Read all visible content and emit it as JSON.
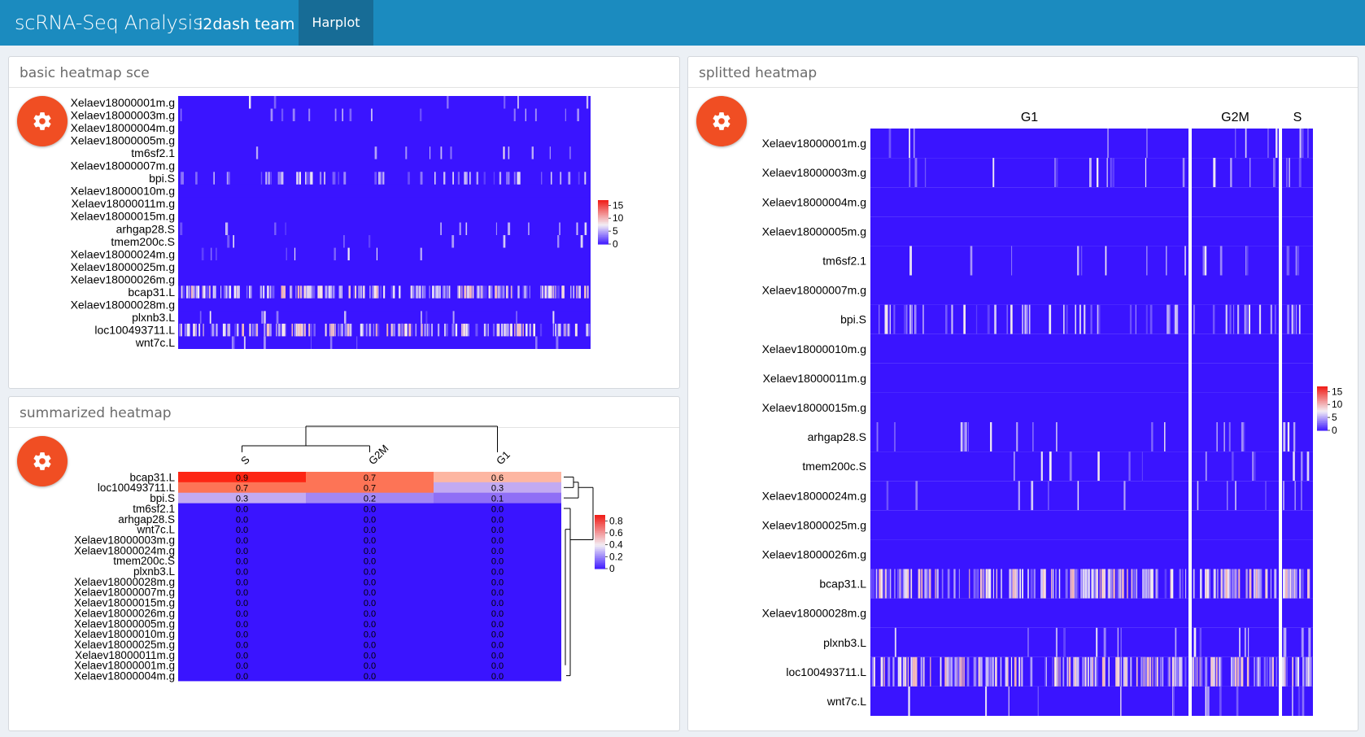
{
  "app": {
    "title": "scRNA-Seq Analysis",
    "author": "i2dash team",
    "tabs": [
      {
        "label": "Harplot",
        "active": true
      }
    ]
  },
  "colors": {
    "navbar": "#1b8bbf",
    "active_tab": "#176c96",
    "gear_button": "#f04e23",
    "heat_low": "#3a14ff",
    "heat_mid": "#f3eef5",
    "heat_high": "#f0211c"
  },
  "icons": {
    "settings": "gear-icon"
  },
  "panels": {
    "basic": {
      "title": "basic heatmap sce"
    },
    "summarized": {
      "title": "summarized heatmap"
    },
    "splitted": {
      "title": "splitted heatmap"
    }
  },
  "chart_data": [
    {
      "id": "basic",
      "type": "heatmap",
      "rows": [
        "Xelaev18000001m.g",
        "Xelaev18000003m.g",
        "Xelaev18000004m.g",
        "Xelaev18000005m.g",
        "tm6sf2.1",
        "Xelaev18000007m.g",
        "bpi.S",
        "Xelaev18000010m.g",
        "Xelaev18000011m.g",
        "Xelaev18000015m.g",
        "arhgap28.S",
        "tmem200c.S",
        "Xelaev18000024m.g",
        "Xelaev18000025m.g",
        "Xelaev18000026m.g",
        "bcap31.L",
        "Xelaev18000028m.g",
        "plxnb3.L",
        "loc100493711.L",
        "wnt7c.L"
      ],
      "row_expression_level": [
        0.01,
        0.05,
        0.0,
        0.0,
        0.03,
        0.0,
        0.2,
        0.0,
        0.0,
        0.0,
        0.04,
        0.02,
        0.02,
        0.0,
        0.0,
        0.7,
        0.0,
        0.03,
        0.6,
        0.02
      ],
      "legend": {
        "ticks": [
          "15",
          "10",
          "5",
          "0"
        ],
        "range": [
          0,
          17
        ]
      }
    },
    {
      "id": "summarized",
      "type": "heatmap",
      "columns": [
        "S",
        "G2M",
        "G1"
      ],
      "rows": [
        "bcap31.L",
        "loc100493711.L",
        "bpi.S",
        "tm6sf2.1",
        "arhgap28.S",
        "wnt7c.L",
        "Xelaev18000003m.g",
        "Xelaev18000024m.g",
        "tmem200c.S",
        "plxnb3.L",
        "Xelaev18000028m.g",
        "Xelaev18000007m.g",
        "Xelaev18000015m.g",
        "Xelaev18000026m.g",
        "Xelaev18000005m.g",
        "Xelaev18000010m.g",
        "Xelaev18000025m.g",
        "Xelaev18000011m.g",
        "Xelaev18000001m.g",
        "Xelaev18000004m.g"
      ],
      "values": [
        [
          0.9,
          0.7,
          0.6
        ],
        [
          0.7,
          0.7,
          0.3
        ],
        [
          0.3,
          0.2,
          0.1
        ],
        [
          0.0,
          0.0,
          0.0
        ],
        [
          0.0,
          0.0,
          0.0
        ],
        [
          0.0,
          0.0,
          0.0
        ],
        [
          0.0,
          0.0,
          0.0
        ],
        [
          0.0,
          0.0,
          0.0
        ],
        [
          0.0,
          0.0,
          0.0
        ],
        [
          0.0,
          0.0,
          0.0
        ],
        [
          0.0,
          0.0,
          0.0
        ],
        [
          0.0,
          0.0,
          0.0
        ],
        [
          0.0,
          0.0,
          0.0
        ],
        [
          0.0,
          0.0,
          0.0
        ],
        [
          0.0,
          0.0,
          0.0
        ],
        [
          0.0,
          0.0,
          0.0
        ],
        [
          0.0,
          0.0,
          0.0
        ],
        [
          0.0,
          0.0,
          0.0
        ],
        [
          0.0,
          0.0,
          0.0
        ],
        [
          0.0,
          0.0,
          0.0
        ]
      ],
      "cell_labels": [
        [
          "0.9",
          "0.7",
          "0.6"
        ],
        [
          "0.7",
          "0.7",
          "0.3"
        ],
        [
          "0.3",
          "0.2",
          "0.1"
        ],
        [
          "0.0",
          "0.0",
          "0.0"
        ],
        [
          "0.0",
          "0.0",
          "0.0"
        ],
        [
          "0.0",
          "0.0",
          "0.0"
        ],
        [
          "0.0",
          "0.0",
          "0.0"
        ],
        [
          "0.0",
          "0.0",
          "0.0"
        ],
        [
          "0.0",
          "0.0",
          "0.0"
        ],
        [
          "0.0",
          "0.0",
          "0.0"
        ],
        [
          "0.0",
          "0.0",
          "0.0"
        ],
        [
          "0.0",
          "0.0",
          "0.0"
        ],
        [
          "0.0",
          "0.0",
          "0.0"
        ],
        [
          "0.0",
          "0.0",
          "0.0"
        ],
        [
          "0.0",
          "0.0",
          "0.0"
        ],
        [
          "0.0",
          "0.0",
          "0.0"
        ],
        [
          "0.0",
          "0.0",
          "0.0"
        ],
        [
          "0.0",
          "0.0",
          "0.0"
        ],
        [
          "0.0",
          "0.0",
          "0.0"
        ],
        [
          "0.0",
          "0.0",
          "0.0"
        ]
      ],
      "legend": {
        "ticks": [
          "0.8",
          "0.6",
          "0.4",
          "0.2",
          "0"
        ],
        "range": [
          0,
          0.9
        ]
      }
    },
    {
      "id": "splitted",
      "type": "heatmap",
      "groups": [
        "G1",
        "G2M",
        "S"
      ],
      "group_cell_share": [
        0.73,
        0.2,
        0.07
      ],
      "rows": [
        "Xelaev18000001m.g",
        "Xelaev18000003m.g",
        "Xelaev18000004m.g",
        "Xelaev18000005m.g",
        "tm6sf2.1",
        "Xelaev18000007m.g",
        "bpi.S",
        "Xelaev18000010m.g",
        "Xelaev18000011m.g",
        "Xelaev18000015m.g",
        "arhgap28.S",
        "tmem200c.S",
        "Xelaev18000024m.g",
        "Xelaev18000025m.g",
        "Xelaev18000026m.g",
        "bcap31.L",
        "Xelaev18000028m.g",
        "plxnb3.L",
        "loc100493711.L",
        "wnt7c.L"
      ],
      "row_expression_level": [
        0.01,
        0.05,
        0.0,
        0.0,
        0.03,
        0.0,
        0.2,
        0.0,
        0.0,
        0.0,
        0.04,
        0.02,
        0.02,
        0.0,
        0.0,
        0.7,
        0.0,
        0.03,
        0.6,
        0.02
      ],
      "legend": {
        "ticks": [
          "15",
          "10",
          "5",
          "0"
        ],
        "range": [
          0,
          17
        ]
      }
    }
  ]
}
